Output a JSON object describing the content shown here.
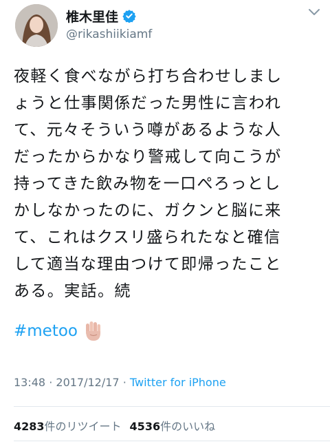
{
  "user": {
    "display_name": "椎木里佳",
    "handle": "@rikashiikiamf",
    "verified": true,
    "verified_color": "#1da1f2"
  },
  "tweet": {
    "lines": [
      "夜軽く食べながら打ち合わせしまし",
      "ょうと仕事関係だった男性に言われ",
      "て、元々そういう噂があるような人",
      "だったからかなり警戒して向こうが",
      "持ってきた飲み物を一口ぺろっとし",
      "かしなかったのに、ガクンと脳に来",
      "て、これはクスリ盛られたなと確信",
      "して適当な理由つけて即帰ったこと",
      "ある。実話。続"
    ],
    "hashtag": "#metoo",
    "hashtag_emoji": "raised-hand-emoji",
    "link_color": "#1da1f2"
  },
  "meta": {
    "time": "13:48",
    "sep1": "·",
    "date": "2017/12/17",
    "sep2": "·",
    "client": "Twitter for iPhone"
  },
  "stats": {
    "retweets_count": "4283",
    "retweets_label": "件のリツイート",
    "likes_count": "4536",
    "likes_label": "件のいいね"
  },
  "icons": {
    "menu": "chevron-down-icon",
    "verified": "verified-badge-icon"
  }
}
